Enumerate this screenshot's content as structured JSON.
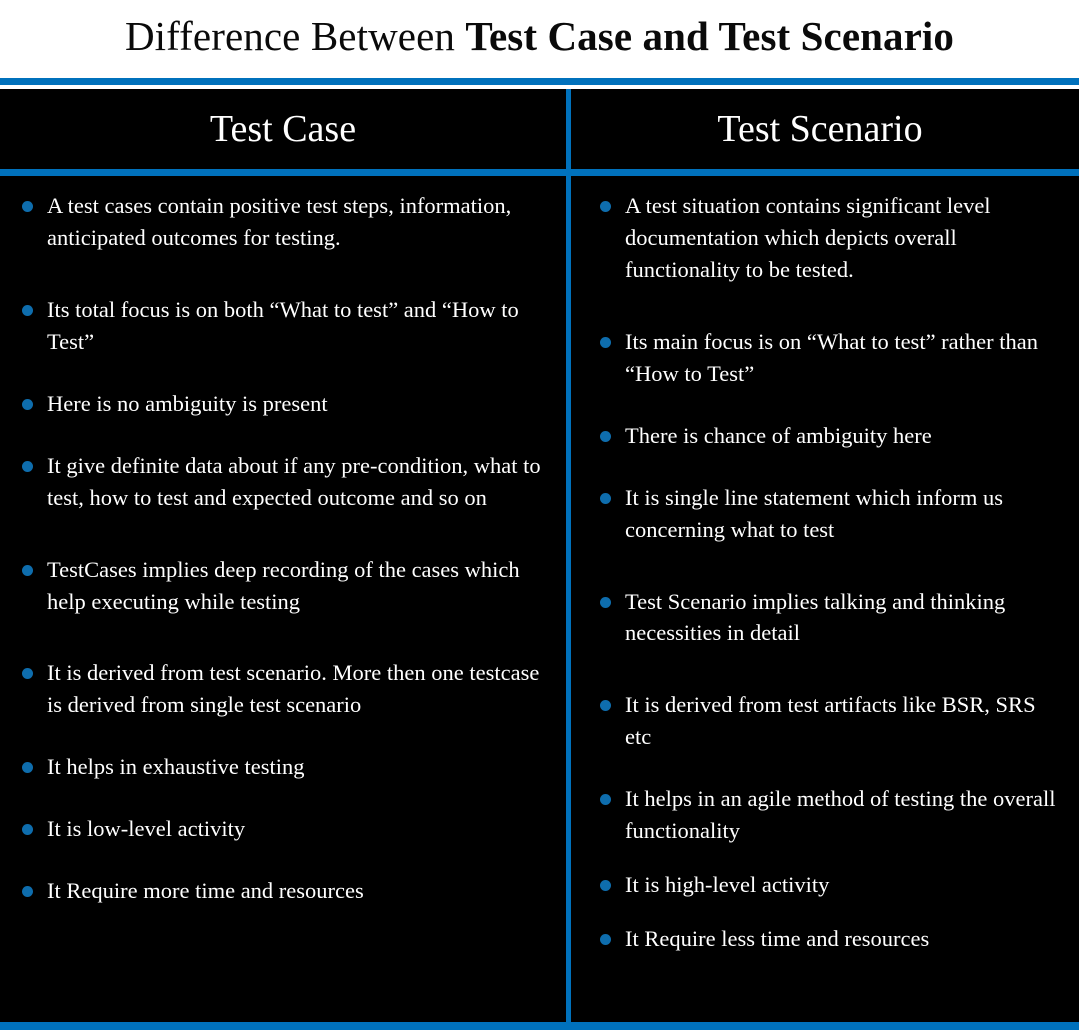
{
  "title": {
    "prefix": "Difference Between ",
    "bold": "Test Case and Test Scenario"
  },
  "colors": {
    "accent_blue": "#0071bc",
    "bullet_blue": "#0e6dad",
    "background": "#000000",
    "page_background": "#ffffff",
    "text": "#ffffff",
    "title_text": "#0a0a0a"
  },
  "columns": [
    {
      "header": "Test Case",
      "items": [
        "A test cases contain positive test steps, information, anticipated outcomes for testing.",
        "Its total focus is on both “What to test” and “How to Test”",
        "Here is no ambiguity is present",
        "It give definite data about if any pre-condition, what to test, how to test and expected outcome and so on",
        "TestCases implies deep recording of the cases which help executing while testing",
        "It is derived from test scenario. More then one testcase is derived from single test scenario",
        "It helps in exhaustive testing",
        "It is low-level activity",
        "It Require more time and resources"
      ]
    },
    {
      "header": "Test Scenario",
      "items": [
        "A test situation contains significant level documentation which depicts overall functionality to be tested.",
        "Its main focus is on “What to test” rather than “How to Test”",
        "There is chance of ambiguity here",
        "It is single line statement which inform us concerning what to test",
        "Test Scenario implies talking and thinking necessities in detail",
        "It is derived from test artifacts like BSR, SRS etc",
        "It helps in an agile method of testing the overall functionality",
        "It is high-level activity",
        "It Require less time and resources"
      ]
    }
  ]
}
